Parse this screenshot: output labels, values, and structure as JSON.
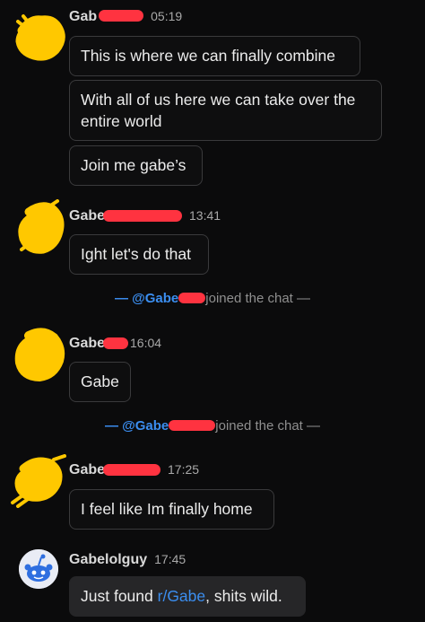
{
  "messages": [
    {
      "name": "Gab",
      "time": "05:19",
      "bubbles": [
        "This is where we can finally combine",
        "With all of us here we can take over the entire world",
        "Join me gabe’s"
      ]
    },
    {
      "name": "Gabe",
      "time": "13:41",
      "bubbles": [
        "Ight let's do that"
      ]
    },
    {
      "system_prefix": "— @Gabe",
      "system_suffix": "joined the chat —"
    },
    {
      "name": "Gabe",
      "time": "16:04",
      "bubbles": [
        "Gabe"
      ]
    },
    {
      "system_prefix": "— @Gabe",
      "system_suffix": "joined the chat —"
    },
    {
      "name": "Gabe",
      "time": "17:25",
      "bubbles": [
        "I feel like Im finally home"
      ]
    },
    {
      "name": "Gabelolguy",
      "time": "17:45",
      "bubble_before": "Just found ",
      "bubble_link": "r/Gabe",
      "bubble_after": ", shits wild."
    }
  ],
  "colors": {
    "background": "#0b0b0c",
    "redaction": "#ff3340",
    "avatar_scribble": "#ffc800",
    "mention": "#3b8ef0"
  },
  "icons": {
    "scribbled_avatar": "yellow-scribble-avatar",
    "bot_avatar": "snoo-avatar-icon"
  }
}
